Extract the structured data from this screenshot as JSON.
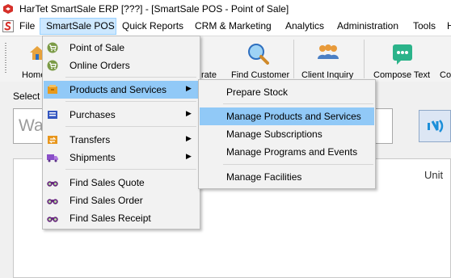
{
  "window": {
    "title": "HarTet SmartSale ERP [???] - [SmartSale POS - Point of Sale]"
  },
  "menubar": {
    "file": "File",
    "smartsale_pos": "SmartSale POS",
    "quick_reports": "Quick Reports",
    "crm_marketing": "CRM & Marketing",
    "analytics": "Analytics",
    "administration": "Administration",
    "tools": "Tools",
    "help": "H"
  },
  "ribbon": {
    "home": "Home",
    "calculate": "rate",
    "find_customer": "Find Customer",
    "client_inquiry": "Client Inquiry",
    "compose_text": "Compose Text",
    "compose": "Co"
  },
  "content": {
    "select_label": "Select",
    "search_value": "Wal",
    "grid_unit_header": "Unit"
  },
  "dropdown": {
    "items": [
      {
        "label": "Point of Sale",
        "icon": "cart-icon",
        "color": "#6b8e3a"
      },
      {
        "label": "Online Orders",
        "icon": "cart-icon",
        "color": "#6b8e3a"
      },
      {
        "label": "Products and Services",
        "icon": "products-icon",
        "color": "#e89a1c",
        "highlighted": true,
        "submenu": true
      },
      {
        "label": "Purchases",
        "icon": "purchases-icon",
        "color": "#2e4fb5",
        "submenu": true
      },
      {
        "label": "Transfers",
        "icon": "transfers-icon",
        "color": "#e8961c",
        "submenu": true
      },
      {
        "label": "Shipments",
        "icon": "shipments-icon",
        "color": "#8a4fc8",
        "submenu": true
      },
      {
        "label": "Find Sales Quote",
        "icon": "binoculars-icon",
        "color": "#7a2f8f"
      },
      {
        "label": "Find Sales Order",
        "icon": "binoculars-icon",
        "color": "#7a2f8f"
      },
      {
        "label": "Find Sales Receipt",
        "icon": "binoculars-icon",
        "color": "#7a2f8f"
      }
    ]
  },
  "submenu": {
    "items": [
      {
        "label": "Prepare Stock"
      },
      {
        "label": "Manage Products and Services",
        "highlighted": true
      },
      {
        "label": "Manage Subscriptions"
      },
      {
        "label": "Manage Programs and Events"
      },
      {
        "label": "Manage Facilities"
      }
    ]
  },
  "colors": {
    "menu_highlight": "#91c9f7",
    "menubar_active": "#cde8ff",
    "accent": "#1c8fd9"
  }
}
